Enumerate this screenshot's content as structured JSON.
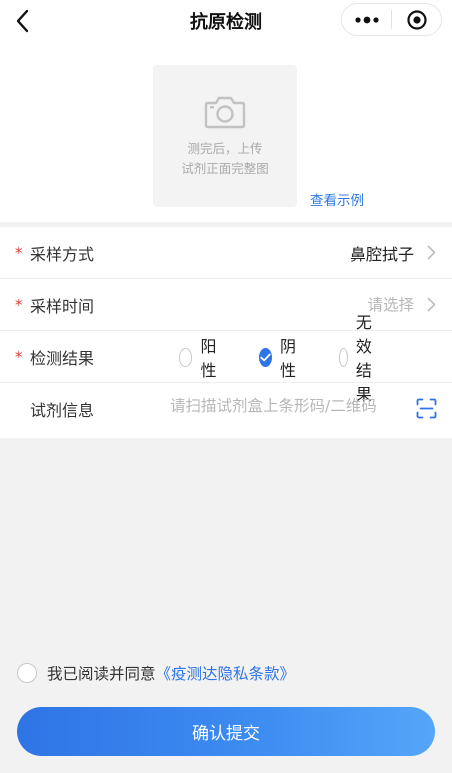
{
  "header": {
    "title": "抗原检测"
  },
  "upload": {
    "hint_line1": "测完后，上传",
    "hint_line2": "试剂正面完整图",
    "example_link": "查看示例"
  },
  "form": {
    "sampling_method": {
      "label": "采样方式",
      "value": "鼻腔拭子"
    },
    "sampling_time": {
      "label": "采样时间",
      "placeholder": "请选择"
    },
    "result": {
      "label": "检测结果",
      "options": [
        "阳性",
        "阴性",
        "无效结果"
      ],
      "selected": "阴性"
    },
    "reagent": {
      "label": "试剂信息",
      "placeholder": "请扫描试剂盒上条形码/二维码"
    }
  },
  "agreement": {
    "text": "我已阅读并同意",
    "link": "《疫测达隐私条款》"
  },
  "submit_label": "确认提交",
  "colors": {
    "accent": "#2f74e6",
    "required": "#e0403a",
    "link": "#2f7ae5"
  }
}
